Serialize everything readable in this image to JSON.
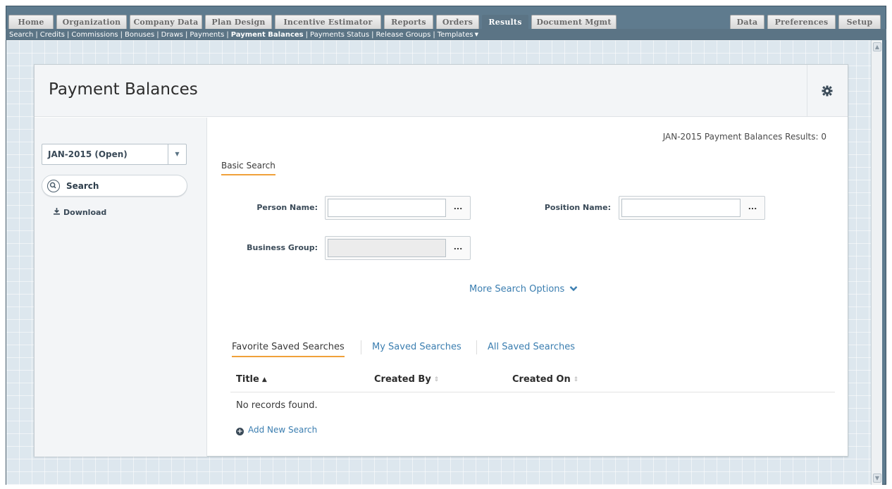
{
  "top_nav": {
    "tabs": [
      {
        "label": "Home"
      },
      {
        "label": "Organization"
      },
      {
        "label": "Company Data"
      },
      {
        "label": "Plan Design"
      },
      {
        "label": "Incentive Estimator"
      },
      {
        "label": "Reports"
      },
      {
        "label": "Orders"
      },
      {
        "label": "Results",
        "active": true
      },
      {
        "label": "Document Mgmt"
      }
    ],
    "right_tabs": [
      {
        "label": "Data"
      },
      {
        "label": "Preferences"
      },
      {
        "label": "Setup"
      }
    ]
  },
  "sub_nav": {
    "links": [
      {
        "label": "Search"
      },
      {
        "label": "Credits"
      },
      {
        "label": "Commissions"
      },
      {
        "label": "Bonuses"
      },
      {
        "label": "Draws"
      },
      {
        "label": "Payments"
      },
      {
        "label": "Payment Balances",
        "current": true
      },
      {
        "label": "Payments Status"
      },
      {
        "label": "Release Groups"
      },
      {
        "label": "Templates"
      }
    ],
    "separator": "|"
  },
  "header": {
    "title": "Payment Balances",
    "settings_icon": "gear-icon"
  },
  "sidebar": {
    "period": "JAN-2015 (Open)",
    "search_label": "Search",
    "download_label": "Download"
  },
  "main": {
    "results_text": "JAN-2015 Payment Balances Results: 0",
    "basic_search_tab": "Basic Search",
    "fields": {
      "person_name_label": "Person Name:",
      "position_name_label": "Position Name:",
      "business_group_label": "Business Group:",
      "lookup_button": "..."
    },
    "more_options": "More Search Options",
    "saved_tabs": [
      {
        "label": "Favorite Saved Searches",
        "active": true
      },
      {
        "label": "My Saved Searches"
      },
      {
        "label": "All Saved Searches"
      }
    ],
    "columns": [
      "Title",
      "Created By",
      "Created On"
    ],
    "empty_text": "No records found.",
    "add_new": "Add New Search"
  },
  "colors": {
    "nav_active": "#5b7485",
    "accent_underline": "#f0a13a",
    "link": "#3b7eb0"
  }
}
